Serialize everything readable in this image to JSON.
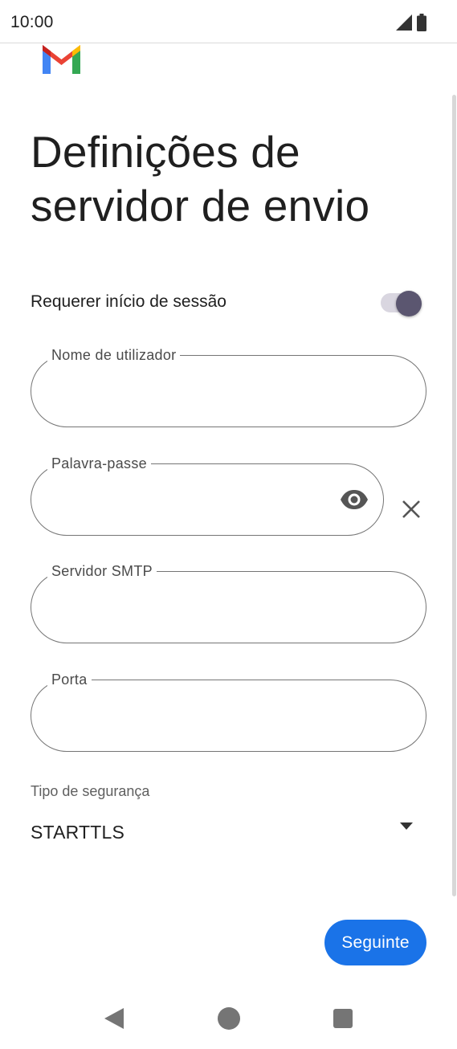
{
  "status_bar": {
    "time": "10:00",
    "icons": [
      "signal-icon",
      "battery-icon"
    ]
  },
  "app": {
    "logo": "gmail-logo-icon"
  },
  "page": {
    "title": "Definições de servidor de envio"
  },
  "login_toggle": {
    "label": "Requerer início de sessão",
    "on": true
  },
  "fields": {
    "username": {
      "label": "Nome de utilizador",
      "value": ""
    },
    "password": {
      "label": "Palavra-passe",
      "value": ""
    },
    "smtp_server": {
      "label": "Servidor SMTP",
      "value": ""
    },
    "port": {
      "label": "Porta",
      "value": ""
    }
  },
  "security": {
    "label": "Tipo de segurança",
    "value": "STARTTLS"
  },
  "actions": {
    "next_label": "Seguinte"
  },
  "colors": {
    "accent": "#1a73e8",
    "toggle_thumb": "#5b5670",
    "toggle_track": "#d9d6e0"
  },
  "nav_bar": {
    "icons": [
      "back-icon",
      "home-icon",
      "recents-icon"
    ]
  }
}
